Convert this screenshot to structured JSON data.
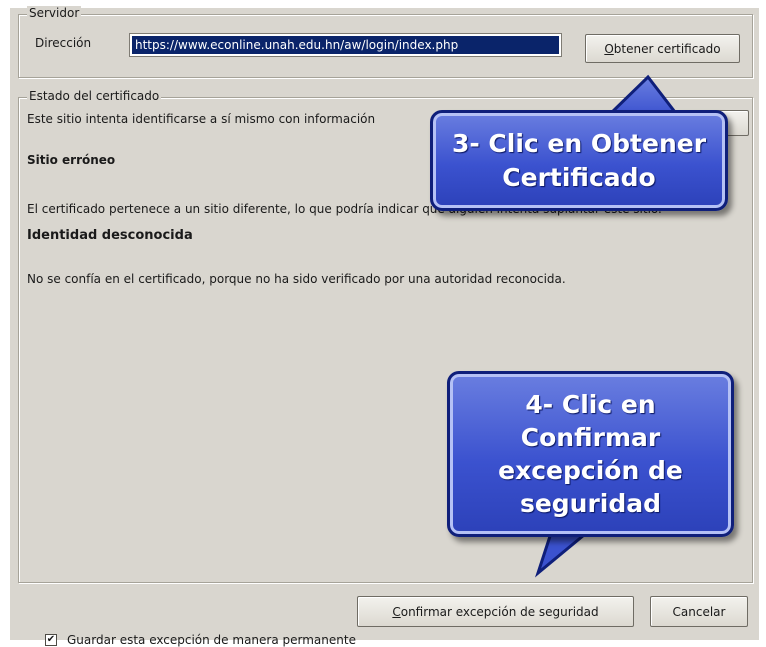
{
  "server": {
    "legend": "Servidor",
    "address_label": "Dirección",
    "address_value": "https://www.econline.unah.edu.hn/aw/login/index.php",
    "get_certificate_label_prefix": "O",
    "get_certificate_label_rest": "btener certificado"
  },
  "status": {
    "legend": "Estado del certificado",
    "description": "Este sitio intenta identificarse a sí mismo con información",
    "view_button_label": "",
    "wrong_site_title": "Sitio erróneo",
    "wrong_site_text": "El certificado pertenece a un sitio diferente, lo que podría indicar que alguien intenta suplantar este sitio.",
    "unknown_identity_title": "Identidad desconocida",
    "unknown_identity_text": "No se confía en el certificado, porque no ha sido verificado por una autoridad reconocida."
  },
  "save_exception": {
    "checked": true,
    "check_glyph": "✔",
    "label": "Guardar esta excepción de manera permanente"
  },
  "buttons": {
    "confirm_prefix": "C",
    "confirm_rest": "onfirmar excepción de seguridad",
    "cancel": "Cancelar"
  },
  "callouts": {
    "step3": "3- Clic en Obtener Certificado",
    "step4": "4- Clic en Confirmar excepción de seguridad"
  },
  "colors": {
    "callout_fill": "#3b52cf",
    "callout_border": "#0f1f7a",
    "selection": "#0a246a",
    "dialog_bg": "#d9d6cf"
  }
}
